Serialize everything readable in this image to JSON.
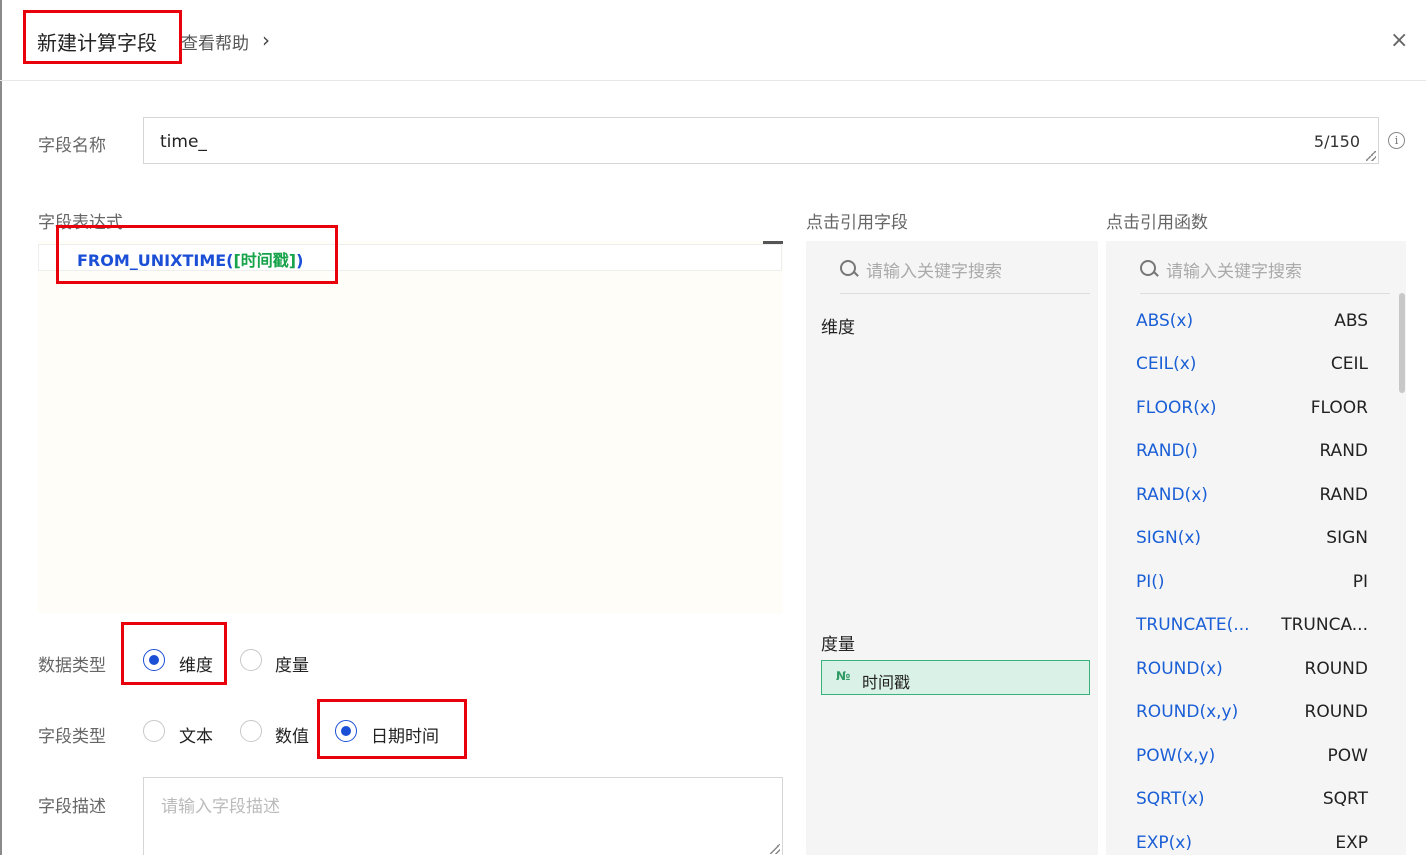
{
  "header": {
    "title": "新建计算字段",
    "help_label": "查看帮助",
    "help_chevron": "›",
    "close_glyph": "×"
  },
  "field_name": {
    "label": "字段名称",
    "value": "time_",
    "counter": "5/150",
    "info_glyph": "i"
  },
  "expression": {
    "label": "字段表达式",
    "func_part": "FROM_UNIXTIME(",
    "field_part": "[时间戳]",
    "close_part": ")"
  },
  "field_panel": {
    "title": "点击引用字段",
    "search_placeholder": "请输入关键字搜索",
    "dimension_label": "维度",
    "measure_label": "度量",
    "measure_fields": [
      {
        "icon": "№",
        "name": "时间戳"
      }
    ]
  },
  "func_panel": {
    "title": "点击引用函数",
    "search_placeholder": "请输入关键字搜索",
    "functions": [
      {
        "sig": "ABS(x)",
        "name": "ABS"
      },
      {
        "sig": "CEIL(x)",
        "name": "CEIL"
      },
      {
        "sig": "FLOOR(x)",
        "name": "FLOOR"
      },
      {
        "sig": "RAND()",
        "name": "RAND"
      },
      {
        "sig": "RAND(x)",
        "name": "RAND"
      },
      {
        "sig": "SIGN(x)",
        "name": "SIGN"
      },
      {
        "sig": "PI()",
        "name": "PI"
      },
      {
        "sig": "TRUNCATE(...",
        "name": "TRUNCA..."
      },
      {
        "sig": "ROUND(x)",
        "name": "ROUND"
      },
      {
        "sig": "ROUND(x,y)",
        "name": "ROUND"
      },
      {
        "sig": "POW(x,y)",
        "name": "POW"
      },
      {
        "sig": "SQRT(x)",
        "name": "SQRT"
      },
      {
        "sig": "EXP(x)",
        "name": "EXP"
      }
    ]
  },
  "data_type": {
    "label": "数据类型",
    "options": [
      {
        "label": "维度",
        "selected": true
      },
      {
        "label": "度量",
        "selected": false
      }
    ]
  },
  "field_type": {
    "label": "字段类型",
    "options": [
      {
        "label": "文本",
        "selected": false
      },
      {
        "label": "数值",
        "selected": false
      },
      {
        "label": "日期时间",
        "selected": true
      }
    ]
  },
  "description": {
    "label": "字段描述",
    "placeholder": "请输入字段描述"
  },
  "colors": {
    "accent": "#1a4fd6",
    "function_link": "#1a5fd6",
    "field_token": "#16a34a",
    "highlight_box": "#e8000b",
    "chip_bg": "#d9f1e6",
    "chip_border": "#39b27a"
  }
}
